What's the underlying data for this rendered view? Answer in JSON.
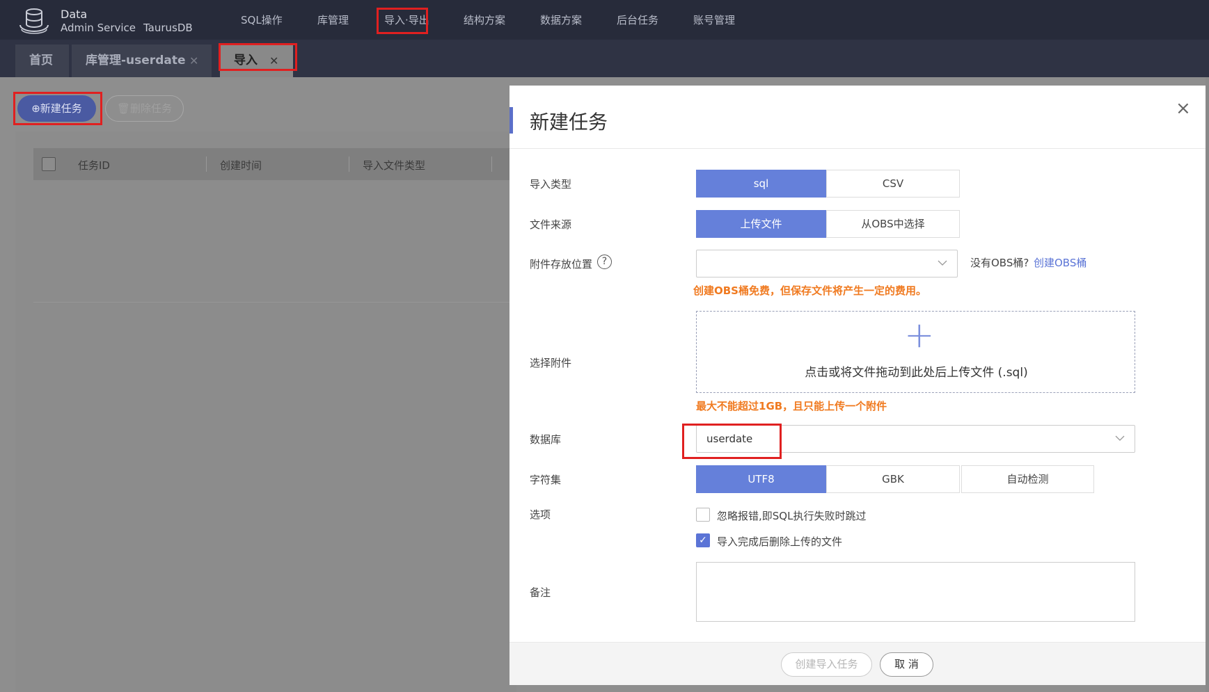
{
  "app": {
    "logo_line1": "Data",
    "logo_line2": "Admin Service",
    "db_name": "TaurusDB"
  },
  "nav": {
    "items": [
      {
        "label": "SQL操作"
      },
      {
        "label": "库管理"
      },
      {
        "label": "导入·导出"
      },
      {
        "label": "结构方案"
      },
      {
        "label": "数据方案"
      },
      {
        "label": "后台任务"
      },
      {
        "label": "账号管理"
      }
    ]
  },
  "tabs": {
    "items": [
      {
        "label": "首页",
        "closable": false
      },
      {
        "label": "库管理-userdate",
        "closable": true
      },
      {
        "label": "导入",
        "closable": true,
        "active": true
      }
    ],
    "close_glyph": "✕"
  },
  "toolbar": {
    "new_task": "⊕新建任务",
    "delete_task": "🗑删除任务"
  },
  "table": {
    "columns": [
      "任务ID",
      "创建时间",
      "导入文件类型"
    ]
  },
  "dialog": {
    "title": "新建任务",
    "close_glyph": "×",
    "import_type": {
      "label": "导入类型",
      "options": [
        "sql",
        "CSV"
      ],
      "selected": "sql"
    },
    "file_source": {
      "label": "文件来源",
      "options": [
        "上传文件",
        "从OBS中选择"
      ],
      "selected": "上传文件"
    },
    "attachment_location": {
      "label": "附件存放位置",
      "help_glyph": "?",
      "value": "",
      "no_obs_text": "没有OBS桶?",
      "create_obs_link": "创建OBS桶",
      "warning": "创建OBS桶免费，但保存文件将产生一定的费用。"
    },
    "attachment": {
      "label": "选择附件",
      "plus_glyph": "+",
      "upload_text": "点击或将文件拖动到此处后上传文件 (.sql)",
      "limit_note": "最大不能超过1GB，且只能上传一个附件"
    },
    "database": {
      "label": "数据库",
      "value": "userdate"
    },
    "charset": {
      "label": "字符集",
      "options": [
        "UTF8",
        "GBK",
        "自动检测"
      ],
      "selected": "UTF8"
    },
    "options": {
      "label": "选项",
      "items": [
        {
          "text": "忽略报错,即SQL执行失败时跳过",
          "checked": false
        },
        {
          "text": "导入完成后删除上传的文件",
          "checked": true
        }
      ],
      "check_glyph": "✓"
    },
    "remarks": {
      "label": "备注",
      "value": ""
    },
    "footer": {
      "create_button": "创建导入任务",
      "cancel_button": "取 消"
    }
  },
  "colors": {
    "nav_bg": "#272b3a",
    "primary": "#6580da",
    "warning": "#f07a20",
    "annotation_red": "#e02020"
  }
}
